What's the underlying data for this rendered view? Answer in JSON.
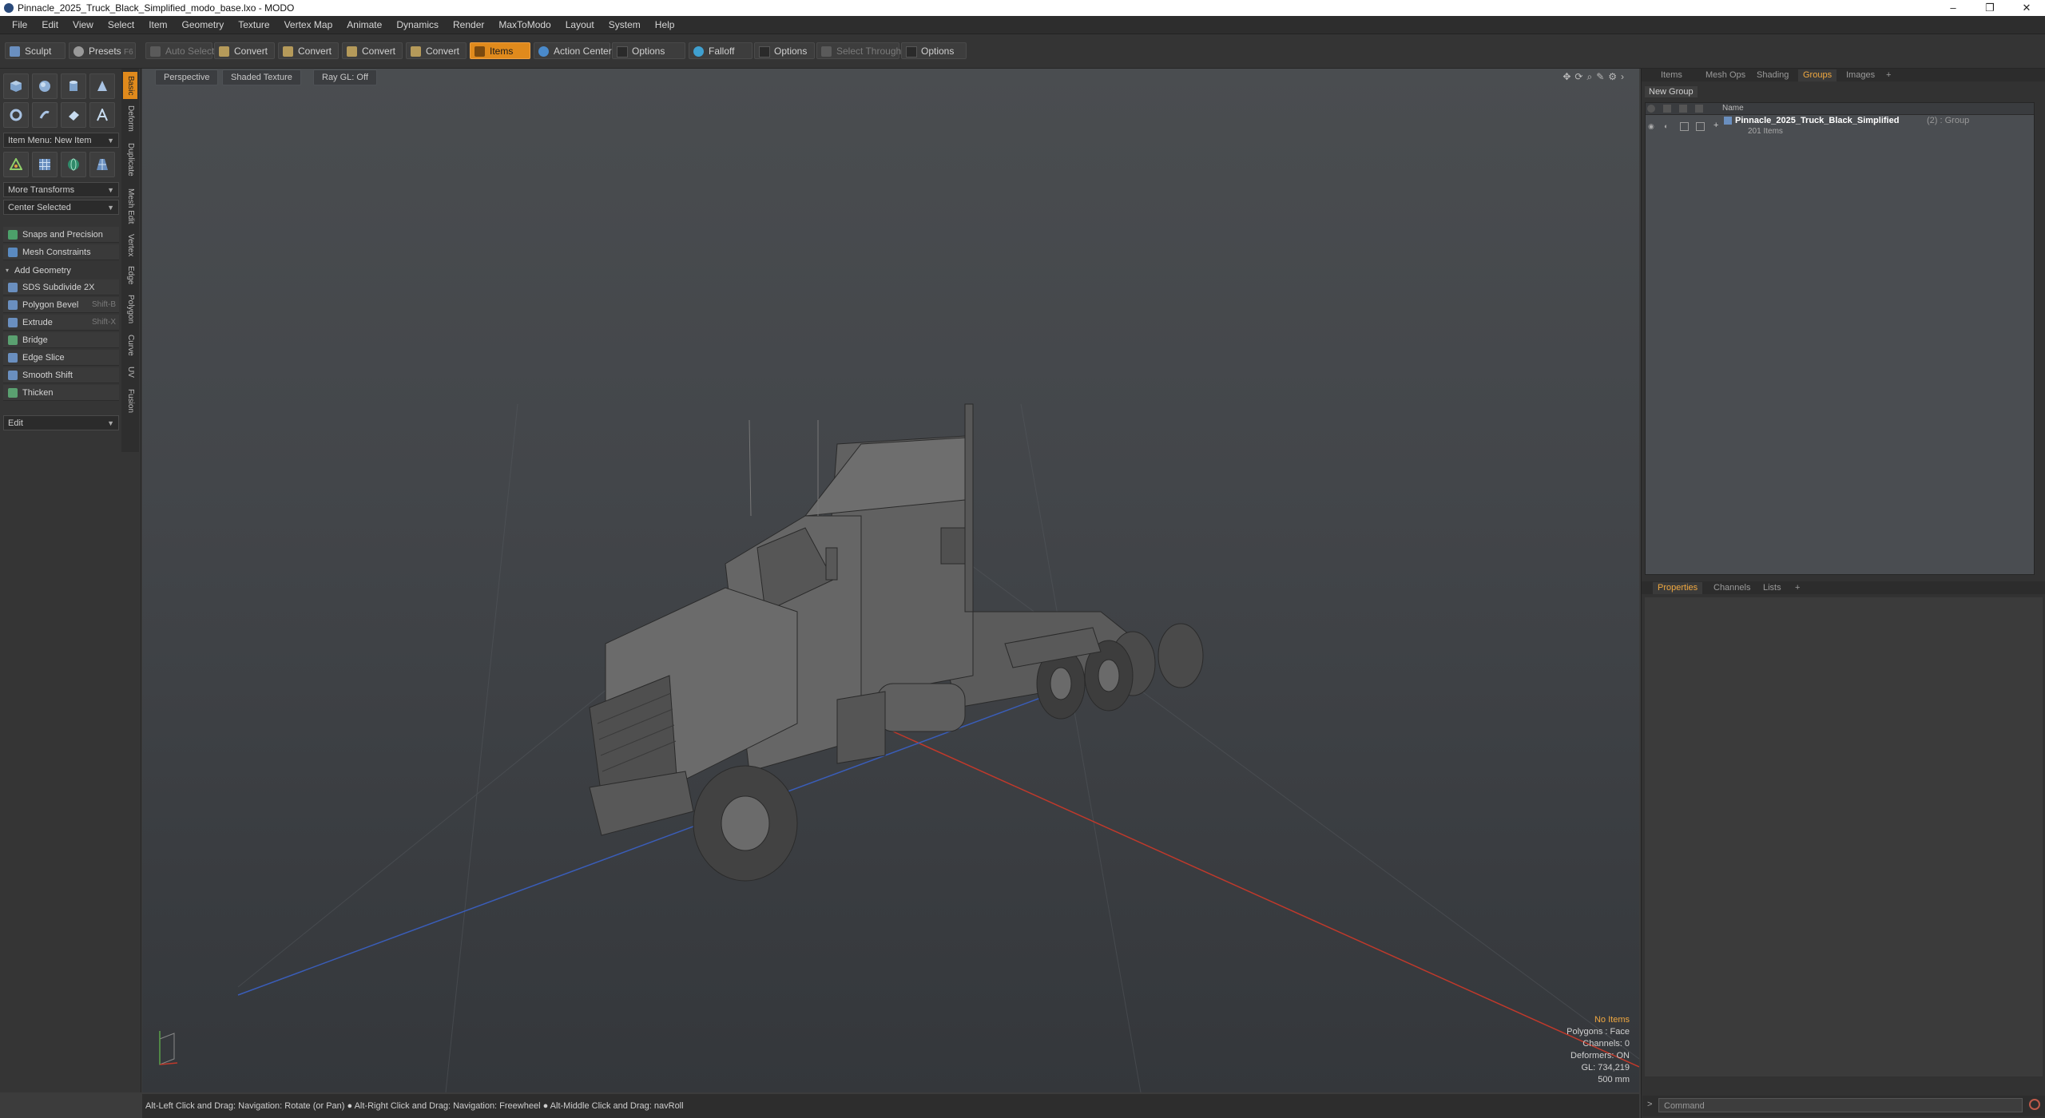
{
  "window": {
    "title": "Pinnacle_2025_Truck_Black_Simplified_modo_base.lxo - MODO",
    "controls": [
      "–",
      "❐",
      "✕"
    ]
  },
  "menubar": [
    "File",
    "Edit",
    "View",
    "Select",
    "Item",
    "Geometry",
    "Texture",
    "Vertex Map",
    "Animate",
    "Dynamics",
    "Render",
    "MaxToModo",
    "Layout",
    "System",
    "Help"
  ],
  "toolbar": {
    "sculpt": "Sculpt",
    "presets": "Presets",
    "presets_key": "F6",
    "auto_select": "Auto Select",
    "convert1": "Convert",
    "convert2": "Convert",
    "convert3": "Convert",
    "convert4": "Convert",
    "items": "Items",
    "action_center": "Action Center",
    "options1": "Options",
    "falloff": "Falloff",
    "options2": "Options",
    "select_through": "Select Through",
    "options3": "Options"
  },
  "left_panel": {
    "vertical_tabs": [
      "Basic",
      "Deform",
      "Duplicate",
      "Mesh Edit",
      "Vertex",
      "Edge",
      "Polygon",
      "Curve",
      "UV",
      "Fusion"
    ],
    "item_menu": "Item Menu: New Item",
    "more_transforms": "More Transforms",
    "center_selected": "Center Selected",
    "snaps": "Snaps and Precision",
    "mesh_constraints": "Mesh Constraints",
    "add_geometry": "Add Geometry",
    "tools": [
      {
        "label": "SDS Subdivide 2X",
        "shortcut": ""
      },
      {
        "label": "Polygon Bevel",
        "shortcut": "Shift-B"
      },
      {
        "label": "Extrude",
        "shortcut": "Shift-X"
      },
      {
        "label": "Bridge",
        "shortcut": ""
      },
      {
        "label": "Edge Slice",
        "shortcut": ""
      },
      {
        "label": "Smooth Shift",
        "shortcut": ""
      },
      {
        "label": "Thicken",
        "shortcut": ""
      }
    ],
    "edit": "Edit"
  },
  "viewport": {
    "perspective": "Perspective",
    "shading": "Shaded Texture",
    "raygl": "Ray GL: Off",
    "stats": {
      "selection": "No Items",
      "polygons": "Polygons : Face",
      "channels": "Channels: 0",
      "deformers": "Deformers: ON",
      "gl": "GL: 734,219",
      "scale": "500 mm"
    }
  },
  "status_bar": "Alt-Left Click and Drag: Navigation: Rotate (or Pan) ● Alt-Right Click and Drag: Navigation: Freewheel ● Alt-Middle Click and Drag: navRoll",
  "right_panel": {
    "top_tabs": [
      "Items",
      "Mesh Ops",
      "Shading",
      "Groups",
      "Images"
    ],
    "active_top_tab": "Groups",
    "new_group": "New Group",
    "name_header": "Name",
    "group_name": "Pinnacle_2025_Truck_Black_Simplified",
    "group_suffix": "(2) : Group",
    "group_count": "201 Items",
    "bottom_tabs": [
      "Properties",
      "Channels",
      "Lists"
    ],
    "active_bottom_tab": "Properties",
    "command_placeholder": "Command"
  },
  "colors": {
    "accent": "#e08a1c",
    "axis_x": "#c0392b",
    "axis_z": "#3a5db8"
  }
}
